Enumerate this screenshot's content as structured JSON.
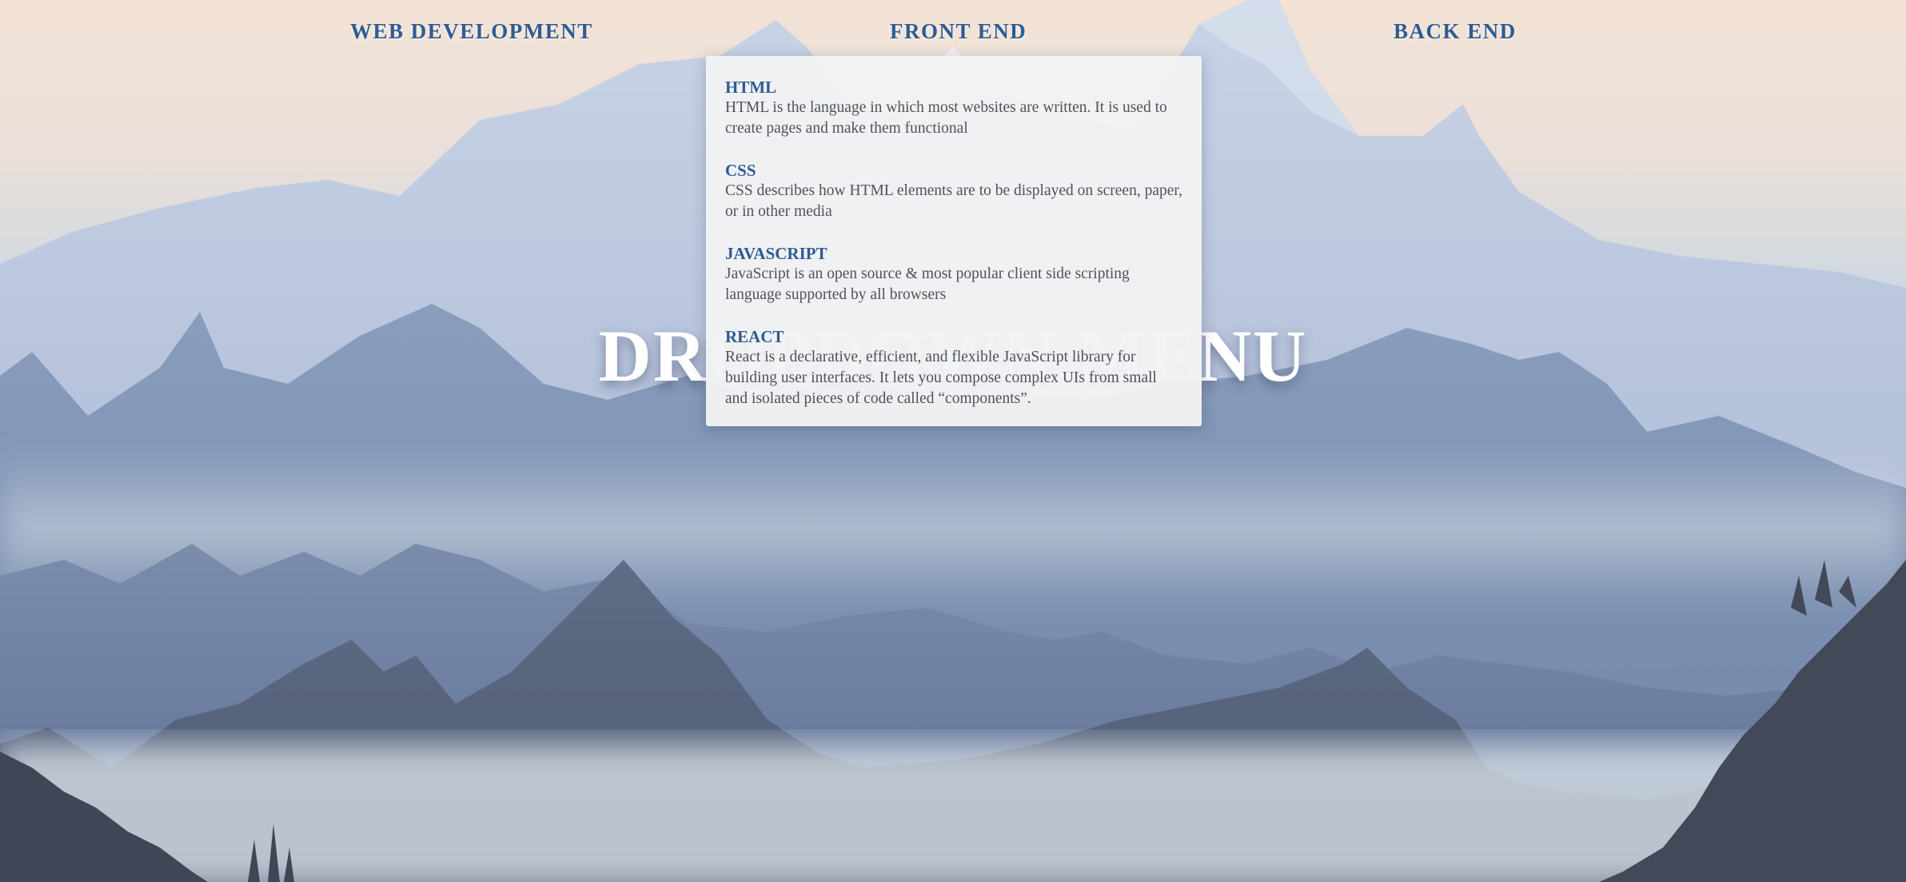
{
  "nav": {
    "items": [
      {
        "label": "WEB DEVELOPMENT"
      },
      {
        "label": "FRONT END"
      },
      {
        "label": "BACK END"
      }
    ]
  },
  "hero": {
    "title": "DROPDOWN MENU"
  },
  "dropdown": {
    "items": [
      {
        "title": "HTML",
        "description": "HTML is the language in which most websites are written. It is used to create pages and make them functional"
      },
      {
        "title": "CSS",
        "description": "CSS describes how HTML elements are to be displayed on screen, paper, or in other media"
      },
      {
        "title": "JAVASCRIPT",
        "description": "JavaScript is an open source & most popular client side scripting language supported by all browsers"
      },
      {
        "title": "REACT",
        "description": "React is a declarative, efficient, and flexible JavaScript library for building user interfaces. It lets you compose complex UIs from small and isolated pieces of code called “components”."
      }
    ]
  },
  "colors": {
    "accent": "#2e5b93",
    "body_text": "#4f5358",
    "dropdown_bg": "#f1f2f4",
    "hero_text": "#ffffff"
  }
}
